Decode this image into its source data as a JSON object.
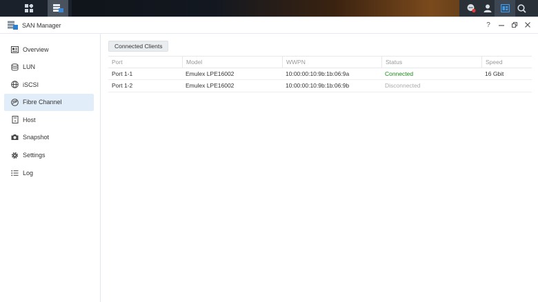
{
  "taskbar": {
    "left_buttons": [
      "grid-menu-icon",
      "san-manager-app-icon"
    ],
    "right_buttons": [
      "chat-notification-icon",
      "user-icon",
      "widgets-icon",
      "search-icon"
    ]
  },
  "window": {
    "title": "SAN Manager",
    "controls": {
      "help": "?"
    }
  },
  "sidebar": {
    "items": [
      {
        "label": "Overview",
        "icon": "overview-icon"
      },
      {
        "label": "LUN",
        "icon": "lun-icon"
      },
      {
        "label": "iSCSI",
        "icon": "iscsi-icon"
      },
      {
        "label": "Fibre Channel",
        "icon": "fibre-channel-icon",
        "active": true
      },
      {
        "label": "Host",
        "icon": "host-icon"
      },
      {
        "label": "Snapshot",
        "icon": "camera-icon"
      },
      {
        "label": "Settings",
        "icon": "gear-icon"
      },
      {
        "label": "Log",
        "icon": "log-icon"
      }
    ]
  },
  "main": {
    "tab_button": "Connected Clients",
    "columns": [
      "Port",
      "Model",
      "WWPN",
      "Status",
      "Speed"
    ],
    "rows": [
      {
        "port": "Port 1-1",
        "model": "Emulex LPE16002",
        "wwpn": "10:00:00:10:9b:1b:06:9a",
        "status": "Connected",
        "speed": "16 Gbit"
      },
      {
        "port": "Port 1-2",
        "model": "Emulex LPE16002",
        "wwpn": "10:00:00:10:9b:1b:06:9b",
        "status": "Disconnected",
        "speed": ""
      }
    ]
  },
  "colors": {
    "status_connected": "#1a8a1a",
    "status_disconnected": "#aaaaaa",
    "active_nav": "#e1edf8"
  }
}
